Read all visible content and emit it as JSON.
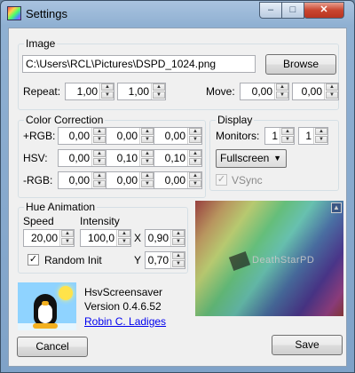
{
  "window": {
    "title": "Settings",
    "min_glyph": "–",
    "max_glyph": "□",
    "close_glyph": "✕"
  },
  "image": {
    "group_title": "Image",
    "path_value": "C:\\Users\\RCL\\Pictures\\DSPD_1024.png",
    "browse_label": "Browse",
    "repeat_label": "Repeat:",
    "repeat_x": "1,00",
    "repeat_y": "1,00",
    "move_label": "Move:",
    "move_x": "0,00",
    "move_y": "0,00"
  },
  "color_correction": {
    "group_title": "Color Correction",
    "rows": [
      {
        "label": "+RGB:",
        "values": [
          "0,00",
          "0,00",
          "0,00"
        ]
      },
      {
        "label": "HSV:",
        "values": [
          "0,00",
          "0,10",
          "0,10"
        ]
      },
      {
        "label": "-RGB:",
        "values": [
          "0,00",
          "0,00",
          "0,00"
        ]
      }
    ]
  },
  "display": {
    "group_title": "Display",
    "monitors_label": "Monitors:",
    "monitors_a": "1",
    "monitors_b": "1",
    "mode_selected": "Fullscreen",
    "vsync_label": "VSync",
    "vsync_checked": true,
    "vsync_enabled": false
  },
  "hue_animation": {
    "group_title": "Hue Animation",
    "speed_label": "Speed",
    "speed_value": "20,00",
    "intensity_label": "Intensity",
    "intensity_value": "100,0",
    "x_label": "X",
    "x_value": "0,90",
    "y_label": "Y",
    "y_value": "0,70",
    "random_init_label": "Random Init",
    "random_init_checked": true
  },
  "preview": {
    "logo_text": "DeathStarPD"
  },
  "about": {
    "app_name": "HsvScreensaver",
    "version": "Version 0.4.6.52",
    "author": "Robin C. Ladiges"
  },
  "footer": {
    "cancel_label": "Cancel",
    "save_label": "Save"
  },
  "icons": {
    "check": "✓",
    "spin_up": "▲",
    "spin_down": "▼",
    "dropdown": "▼"
  }
}
